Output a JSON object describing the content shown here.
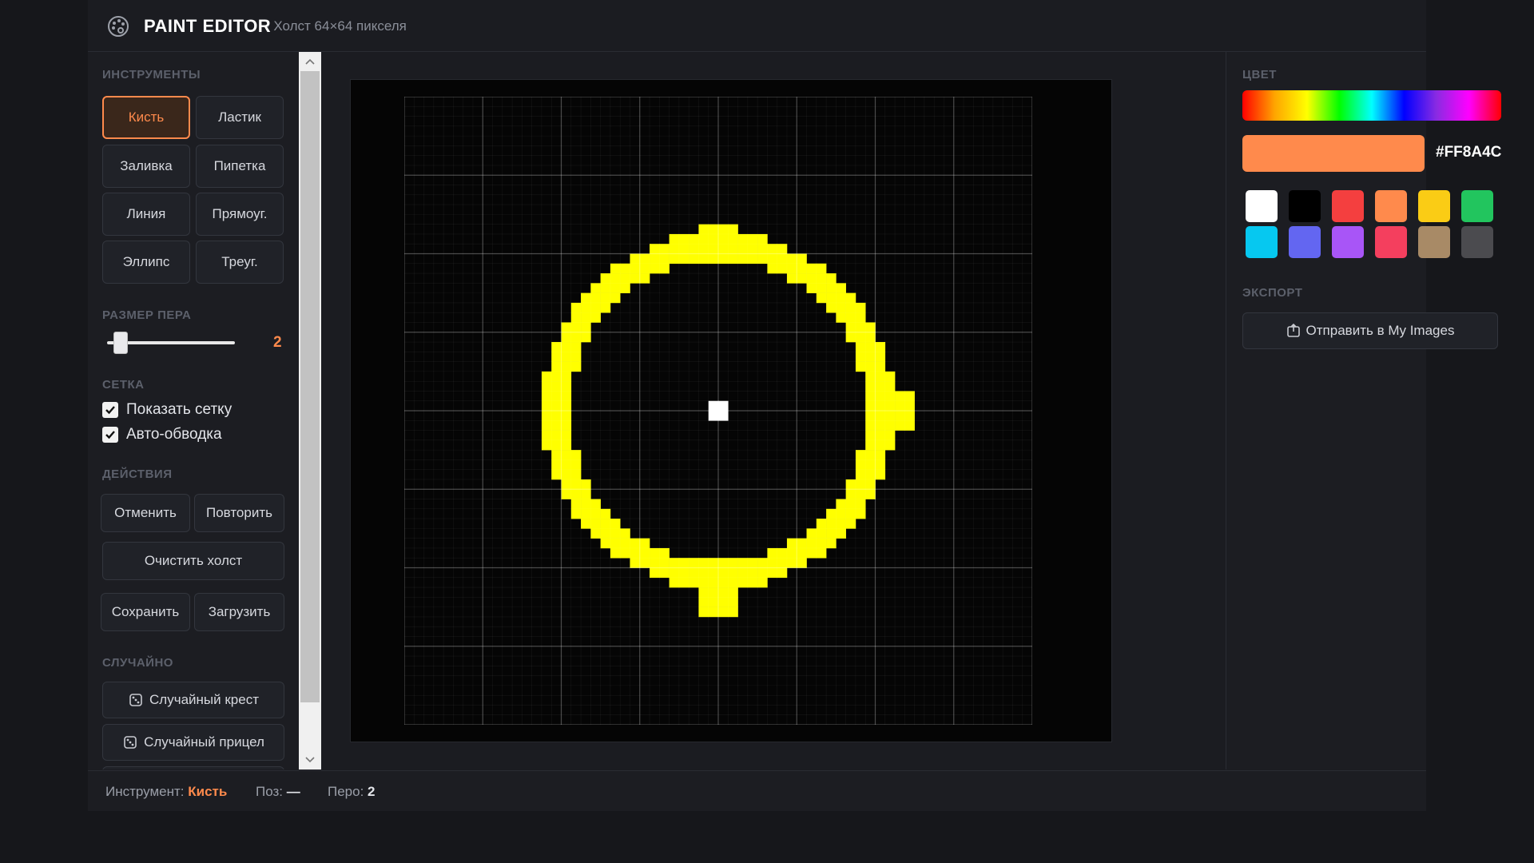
{
  "header": {
    "title": "PAINT EDITOR",
    "subtitle": "· Холст 64×64 пикселя"
  },
  "tools": {
    "section_title": "ИНСТРУМЕНТЫ",
    "items": [
      {
        "label": "Кисть",
        "active": true
      },
      {
        "label": "Ластик",
        "active": false
      },
      {
        "label": "Заливка",
        "active": false
      },
      {
        "label": "Пипетка",
        "active": false
      },
      {
        "label": "Линия",
        "active": false
      },
      {
        "label": "Прямоуг.",
        "active": false
      },
      {
        "label": "Эллипс",
        "active": false
      },
      {
        "label": "Треуг.",
        "active": false
      }
    ]
  },
  "pen_size": {
    "section_title": "РАЗМЕР ПЕРА",
    "value": "2",
    "value_num": 2,
    "min": 1,
    "max": 16
  },
  "grid": {
    "section_title": "СЕТКА",
    "show_grid_label": "Показать сетку",
    "show_grid_checked": true,
    "auto_outline_label": "Авто-обводка",
    "auto_outline_checked": true
  },
  "actions": {
    "section_title": "ДЕЙСТВИЯ",
    "undo": "Отменить",
    "redo": "Повторить",
    "clear": "Очистить холст",
    "save": "Сохранить",
    "load": "Загрузить"
  },
  "random": {
    "section_title": "СЛУЧАЙНО",
    "random_cross": "Случайный крест",
    "random_crosshair": "Случайный прицел"
  },
  "color": {
    "section_title": "ЦВЕТ",
    "current": "#FF8A4C",
    "palette": [
      "#FFFFFF",
      "#000000",
      "#F43F3F",
      "#FF8A4C",
      "#FACC15",
      "#22C55E",
      "#06C8F0",
      "#6366F1",
      "#A855F7",
      "#F43F5E",
      "#A88A66",
      "#4B4B4F"
    ]
  },
  "export": {
    "section_title": "ЭКСПОРТ",
    "send_button": "Отправить в My Images"
  },
  "canvas": {
    "drawing": "yellow crosshair ring with white center dot",
    "ring_color": "#FFFF00",
    "center_color": "#FFFFFF",
    "background_color": "#050505",
    "grid_size": 64
  },
  "status": {
    "tool_label": "Инструмент:",
    "tool_value": "Кисть",
    "pos_label": "Поз:",
    "pos_value": "—",
    "pen_label": "Перо:",
    "pen_value": "2"
  }
}
